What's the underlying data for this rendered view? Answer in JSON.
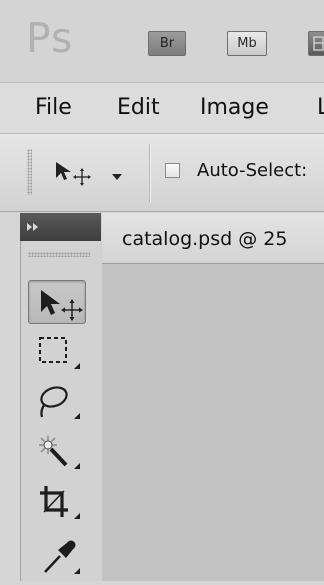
{
  "titlebar": {
    "logo": "Ps",
    "bridge_label": "Br",
    "minibridge_label": "Mb"
  },
  "menubar": {
    "items": [
      "File",
      "Edit",
      "Image",
      "L"
    ]
  },
  "options": {
    "auto_select_label": "Auto-Select:",
    "auto_select_checked": false
  },
  "tools": {
    "items": [
      "move-tool",
      "marquee-tool",
      "lasso-tool",
      "magic-wand-tool",
      "crop-tool",
      "eyedropper-tool"
    ],
    "active": "move-tool"
  },
  "document": {
    "tab_title": "catalog.psd @ 25"
  },
  "colors": {
    "chrome": "#d6d6d6",
    "panel_header": "#464646",
    "canvas": "#c3c3c3"
  }
}
